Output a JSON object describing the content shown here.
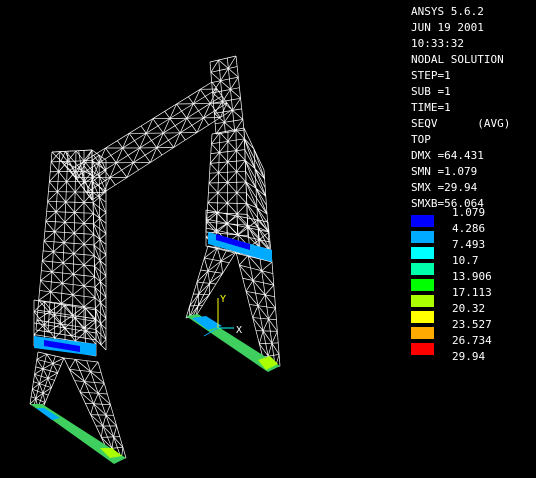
{
  "info_lines": [
    "ANSYS 5.6.2",
    "JUN 19 2001",
    "10:33:32",
    "NODAL SOLUTION",
    "STEP=1",
    "SUB =1",
    "TIME=1",
    "SEQV      (AVG)",
    "TOP",
    "DMX =64.431",
    "SMN =1.079",
    "SMX =29.94",
    "SMXB=56.064"
  ],
  "legend": {
    "values": [
      "1.079",
      "4.286",
      "7.493",
      "10.7",
      "13.906",
      "17.113",
      "20.32",
      "23.527",
      "26.734",
      "29.94"
    ],
    "colors": [
      "#0000ff",
      "#00aaff",
      "#00ffff",
      "#00ffaa",
      "#00ff00",
      "#aaff00",
      "#ffff00",
      "#ffaa00",
      "#ff0000"
    ]
  },
  "triad": {
    "y_label": "Y",
    "x_label": "X"
  },
  "mesh_color": "#ffffff"
}
